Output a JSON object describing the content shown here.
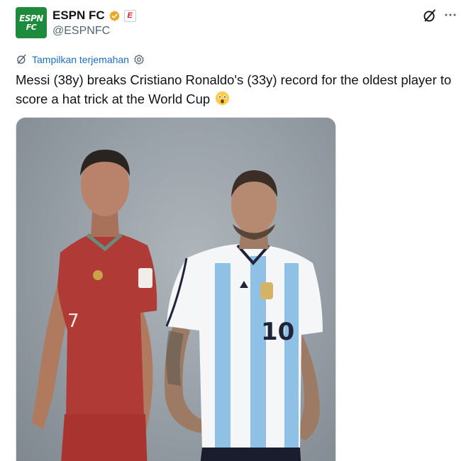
{
  "author": {
    "display_name": "ESPN FC",
    "handle": "@ESPNFC",
    "avatar_line1": "ESPN",
    "avatar_line2": "FC",
    "badge_letter": "E"
  },
  "translate_label": "Tampilkan terjemahan",
  "tweet_text": "Messi (38y) breaks Cristiano Ronaldo's (33y) record for the oldest player to score a hat trick at the World Cup",
  "emoji": "astonished-face",
  "media": {
    "left_player_shirt_number": "7",
    "right_player_shirt_number": "10",
    "left_kit_color": "#b03a35",
    "right_kit_color": "#8fc1e6"
  },
  "colors": {
    "verified": "#e8a92a",
    "link": "#1d6fc2",
    "avatar_bg": "#1e8a3c",
    "badge_red": "#d61e2b"
  }
}
